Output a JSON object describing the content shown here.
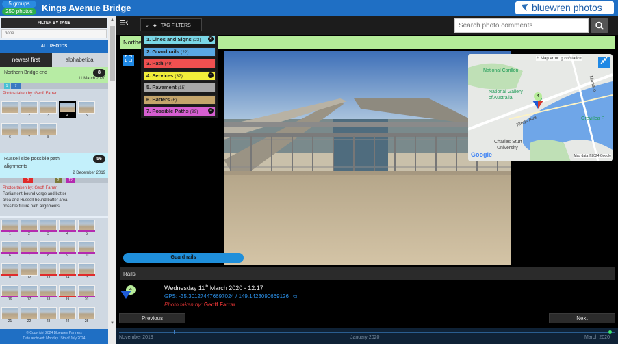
{
  "header": {
    "groups_badge": "5 groups",
    "photos_badge": "250 photos",
    "title": "Kings Avenue Bridge",
    "logo_text": "bluewren photos",
    "accent_color": "#1f6fc4"
  },
  "sidebar": {
    "filter_title": "FILTER BY TAGS",
    "filter_value": "none",
    "all_photos": "ALL PHOTOS",
    "sort_tabs": [
      "newest first",
      "alphabetical"
    ],
    "groups": [
      {
        "name": "Northern Bridge end",
        "count": "8",
        "date": "11 March 2020",
        "tags": [
          "1",
          "7"
        ],
        "taken_by": "Photos taken by: Geoff Farrar",
        "thumbs": [
          "1",
          "2",
          "3",
          "4",
          "5",
          "6",
          "7",
          "8"
        ]
      },
      {
        "name_line1": "Russell side possible path",
        "name_line2": "alignments",
        "count": "56",
        "date": "2 December 2019",
        "tags": [
          "2",
          "2",
          "12"
        ],
        "taken_by": "Photos taken by: Geoff Farrar",
        "desc": [
          "Parliament-bound verge and batter",
          "area and Russell-bound batter area,",
          "possible future path alignments"
        ],
        "thumbs": [
          "1",
          "2",
          "3",
          "4",
          "5",
          "6",
          "7",
          "8",
          "9",
          "10",
          "11",
          "12",
          "13",
          "14",
          "15",
          "16",
          "17",
          "18",
          "19",
          "20",
          "21",
          "22",
          "23",
          "24",
          "25"
        ]
      }
    ],
    "copyright_line1": "© Copyright 2024 Bluewren Partners",
    "copyright_line2": "Date archived: Monday 15th of July 2024"
  },
  "toolbar": {
    "tag_filters_label": "TAG FILTERS",
    "search_placeholder": "Search photo comments"
  },
  "group_banner": "Northern Bridge end",
  "tag_filters": [
    {
      "label": "1. Lines and Signs",
      "count": "(23)",
      "color": "#7ad7e6",
      "dot": "×"
    },
    {
      "label": "2. Guard rails",
      "count": "(22)",
      "color": "#5aa8e3",
      "dot": ""
    },
    {
      "label": "3. Path",
      "count": "(49)",
      "color": "#f05050",
      "dot": ""
    },
    {
      "label": "4. Services",
      "count": "(37)",
      "color": "#f2ee3a",
      "dot": "−"
    },
    {
      "label": "5. Pavement",
      "count": "(15)",
      "color": "#a8a8a8",
      "dot": ""
    },
    {
      "label": "6. Batters",
      "count": "(6)",
      "color": "#c4a56b",
      "dot": ""
    },
    {
      "label": "7. Possible Paths",
      "count": "(99)",
      "color": "#d75fd2",
      "dot": "−"
    }
  ],
  "photo": {
    "tag_pill": "Guard rails",
    "marker_number": "4"
  },
  "map": {
    "error": "⚠ Map error: g.co/staticm",
    "labels": [
      "National Carillon",
      "National Gallery",
      "of Australia",
      "Kings Ave",
      "Grevillea P",
      "Charles Sturt",
      "University",
      "Monaro"
    ],
    "marker_number": "4",
    "google": "Google",
    "mapdata": "Map data ©2024 Google"
  },
  "detail": {
    "section_title": "Rails",
    "marker_number": "4",
    "date_prefix": "Wednesday 11",
    "date_sup": "th",
    "date_suffix": " March 2020 - 12:17",
    "gps": "GPS: -35.301274476697024 / 149.1423090669126",
    "taken_by_label": "Photo taken by: ",
    "taken_by_name": "Geoff Farrar",
    "prev_label": "Previous",
    "next_label": "Next"
  },
  "timeline": {
    "labels": [
      "November 2019",
      "January 2020",
      "March 2020"
    ]
  }
}
